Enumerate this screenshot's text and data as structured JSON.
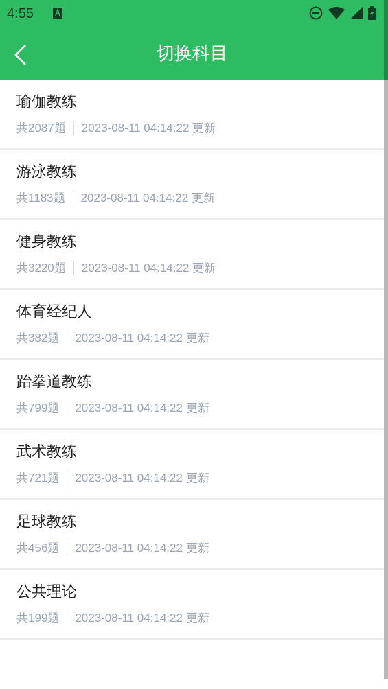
{
  "status_bar": {
    "time": "4:55"
  },
  "toolbar": {
    "title": "切换科目"
  },
  "subjects": [
    {
      "name": "瑜伽教练",
      "count": "共2087题",
      "updated": "2023-08-11 04:14:22 更新"
    },
    {
      "name": "游泳教练",
      "count": "共1183题",
      "updated": "2023-08-11 04:14:22 更新"
    },
    {
      "name": "健身教练",
      "count": "共3220题",
      "updated": "2023-08-11 04:14:22 更新"
    },
    {
      "name": "体育经纪人",
      "count": "共382题",
      "updated": "2023-08-11 04:14:22 更新"
    },
    {
      "name": "跆拳道教练",
      "count": "共799题",
      "updated": "2023-08-11 04:14:22 更新"
    },
    {
      "name": "武术教练",
      "count": "共721题",
      "updated": "2023-08-11 04:14:22 更新"
    },
    {
      "name": "足球教练",
      "count": "共456题",
      "updated": "2023-08-11 04:14:22 更新"
    },
    {
      "name": "公共理论",
      "count": "共199题",
      "updated": "2023-08-11 04:14:22 更新"
    }
  ]
}
